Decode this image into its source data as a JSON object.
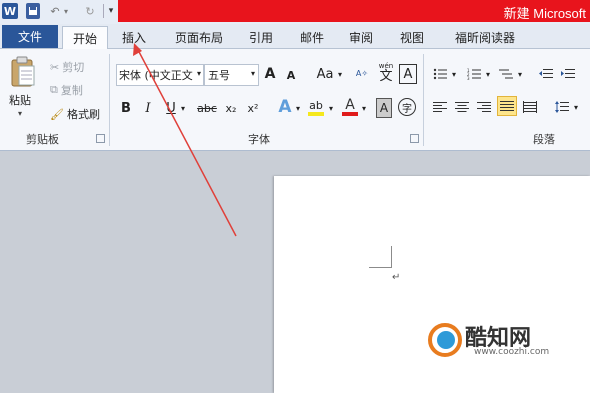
{
  "window": {
    "title": "新建 Microsoft",
    "accent": "#e8141c"
  },
  "qat": {
    "word_icon": "W",
    "save_icon": "save-icon",
    "undo_icon": "undo-icon",
    "redo_icon": "redo-icon"
  },
  "tabs": {
    "file": "文件",
    "home": "开始",
    "insert": "插入",
    "layout": "页面布局",
    "references": "引用",
    "mailings": "邮件",
    "review": "审阅",
    "view": "视图",
    "foxit": "福昕阅读器"
  },
  "clipboard": {
    "paste": "粘贴",
    "cut": "剪切",
    "copy": "复制",
    "format_painter": "格式刷",
    "group": "剪贴板"
  },
  "font": {
    "name": "宋体 (中文正文",
    "size": "五号",
    "group": "字体",
    "grow": "A",
    "shrink": "A",
    "case": "Aa",
    "bold": "B",
    "italic": "I",
    "underline": "U",
    "strike": "abc",
    "sub": "x₂",
    "sup": "x²",
    "effects": "A",
    "highlight": "ab",
    "color": "A",
    "phonetic": "wén",
    "charborder": "A",
    "enclose": "字"
  },
  "paragraph": {
    "group": "段落"
  },
  "document": {
    "para_mark": "↵"
  },
  "watermark": {
    "brand": "酷知网",
    "url": "www.coozhi.com"
  }
}
